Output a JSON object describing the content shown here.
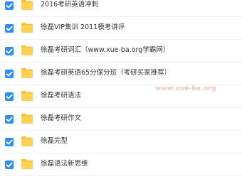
{
  "colors": {
    "checkbox": "#2f8ef5",
    "folder_front": "#ffd15b",
    "folder_back": "#f5c133",
    "text": "#333333"
  },
  "icons": {
    "checkbox": "checkmark-icon",
    "folder": "folder-icon"
  },
  "items": [
    {
      "name": "2016考研英语冲刺",
      "checked": true
    },
    {
      "name": "徐磊VIP集训 2011模考讲评",
      "checked": true
    },
    {
      "name": "徐磊考研词汇（www.xue-ba.org学霸网）",
      "checked": true
    },
    {
      "name": "徐磊考研英语65分保分班（考研买家推荐）",
      "checked": true
    },
    {
      "name": "徐磊考研语法",
      "checked": true
    },
    {
      "name": "徐磊考研作文",
      "checked": true
    },
    {
      "name": "徐磊完型",
      "checked": true
    },
    {
      "name": "徐磊语法新思维",
      "checked": true
    }
  ],
  "watermark": "www.xue-ba.org"
}
